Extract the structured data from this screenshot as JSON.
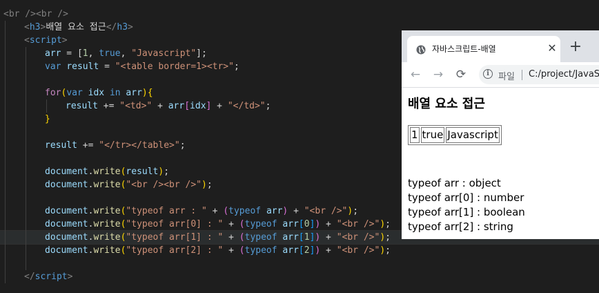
{
  "editor": {
    "lines": [
      {
        "indent": 0,
        "active": false,
        "tokens": [
          {
            "t": "<br /><br />",
            "c": "#808080"
          }
        ]
      },
      {
        "indent": 1,
        "active": false,
        "tokens": [
          {
            "t": "<",
            "c": "#808080"
          },
          {
            "t": "h3",
            "c": "#569cd6"
          },
          {
            "t": ">",
            "c": "#808080"
          },
          {
            "t": "배열 요소 접근",
            "c": "#d4d4d4"
          },
          {
            "t": "</",
            "c": "#808080"
          },
          {
            "t": "h3",
            "c": "#569cd6"
          },
          {
            "t": ">",
            "c": "#808080"
          }
        ]
      },
      {
        "indent": 1,
        "active": false,
        "tokens": [
          {
            "t": "<",
            "c": "#808080"
          },
          {
            "t": "script",
            "c": "#569cd6"
          },
          {
            "t": ">",
            "c": "#808080"
          }
        ]
      },
      {
        "indent": 2,
        "active": false,
        "tokens": [
          {
            "t": "arr",
            "c": "#9cdcfe"
          },
          {
            "t": " = [",
            "c": "#d4d4d4"
          },
          {
            "t": "1",
            "c": "#b5cea8"
          },
          {
            "t": ", ",
            "c": "#d4d4d4"
          },
          {
            "t": "true",
            "c": "#569cd6"
          },
          {
            "t": ", ",
            "c": "#d4d4d4"
          },
          {
            "t": "\"Javascript\"",
            "c": "#ce9178"
          },
          {
            "t": "];",
            "c": "#d4d4d4"
          }
        ]
      },
      {
        "indent": 2,
        "active": false,
        "tokens": [
          {
            "t": "var",
            "c": "#569cd6"
          },
          {
            "t": " ",
            "c": "#d4d4d4"
          },
          {
            "t": "result",
            "c": "#9cdcfe"
          },
          {
            "t": " = ",
            "c": "#d4d4d4"
          },
          {
            "t": "\"<table border=1><tr>\"",
            "c": "#ce9178"
          },
          {
            "t": ";",
            "c": "#d4d4d4"
          }
        ]
      },
      {
        "indent": 0,
        "active": false,
        "tokens": []
      },
      {
        "indent": 2,
        "active": false,
        "tokens": [
          {
            "t": "for",
            "c": "#c586c0"
          },
          {
            "t": "(",
            "c": "#ffd700"
          },
          {
            "t": "var",
            "c": "#569cd6"
          },
          {
            "t": " ",
            "c": "#d4d4d4"
          },
          {
            "t": "idx",
            "c": "#9cdcfe"
          },
          {
            "t": " ",
            "c": "#d4d4d4"
          },
          {
            "t": "in",
            "c": "#569cd6"
          },
          {
            "t": " ",
            "c": "#d4d4d4"
          },
          {
            "t": "arr",
            "c": "#9cdcfe"
          },
          {
            "t": ")",
            "c": "#ffd700"
          },
          {
            "t": "{",
            "c": "#ffd700"
          }
        ]
      },
      {
        "indent": 3,
        "active": false,
        "tokens": [
          {
            "t": "result",
            "c": "#9cdcfe"
          },
          {
            "t": " += ",
            "c": "#d4d4d4"
          },
          {
            "t": "\"<td>\"",
            "c": "#ce9178"
          },
          {
            "t": " + ",
            "c": "#d4d4d4"
          },
          {
            "t": "arr",
            "c": "#9cdcfe"
          },
          {
            "t": "[",
            "c": "#da70d6"
          },
          {
            "t": "idx",
            "c": "#9cdcfe"
          },
          {
            "t": "]",
            "c": "#da70d6"
          },
          {
            "t": " + ",
            "c": "#d4d4d4"
          },
          {
            "t": "\"</td>\"",
            "c": "#ce9178"
          },
          {
            "t": ";",
            "c": "#d4d4d4"
          }
        ]
      },
      {
        "indent": 2,
        "active": false,
        "tokens": [
          {
            "t": "}",
            "c": "#ffd700"
          }
        ]
      },
      {
        "indent": 0,
        "active": false,
        "tokens": []
      },
      {
        "indent": 2,
        "active": false,
        "tokens": [
          {
            "t": "result",
            "c": "#9cdcfe"
          },
          {
            "t": " += ",
            "c": "#d4d4d4"
          },
          {
            "t": "\"</tr></table>\"",
            "c": "#ce9178"
          },
          {
            "t": ";",
            "c": "#d4d4d4"
          }
        ]
      },
      {
        "indent": 0,
        "active": false,
        "tokens": []
      },
      {
        "indent": 2,
        "active": false,
        "tokens": [
          {
            "t": "document",
            "c": "#9cdcfe"
          },
          {
            "t": ".",
            "c": "#d4d4d4"
          },
          {
            "t": "write",
            "c": "#dcdcaa"
          },
          {
            "t": "(",
            "c": "#ffd700"
          },
          {
            "t": "result",
            "c": "#9cdcfe"
          },
          {
            "t": ")",
            "c": "#ffd700"
          },
          {
            "t": ";",
            "c": "#d4d4d4"
          }
        ]
      },
      {
        "indent": 2,
        "active": false,
        "tokens": [
          {
            "t": "document",
            "c": "#9cdcfe"
          },
          {
            "t": ".",
            "c": "#d4d4d4"
          },
          {
            "t": "write",
            "c": "#dcdcaa"
          },
          {
            "t": "(",
            "c": "#ffd700"
          },
          {
            "t": "\"<br /><br />\"",
            "c": "#ce9178"
          },
          {
            "t": ")",
            "c": "#ffd700"
          },
          {
            "t": ";",
            "c": "#d4d4d4"
          }
        ]
      },
      {
        "indent": 0,
        "active": false,
        "tokens": []
      },
      {
        "indent": 2,
        "active": false,
        "tokens": [
          {
            "t": "document",
            "c": "#9cdcfe"
          },
          {
            "t": ".",
            "c": "#d4d4d4"
          },
          {
            "t": "write",
            "c": "#dcdcaa"
          },
          {
            "t": "(",
            "c": "#ffd700"
          },
          {
            "t": "\"typeof arr : \"",
            "c": "#ce9178"
          },
          {
            "t": " + ",
            "c": "#d4d4d4"
          },
          {
            "t": "(",
            "c": "#da70d6"
          },
          {
            "t": "typeof",
            "c": "#569cd6"
          },
          {
            "t": " ",
            "c": "#d4d4d4"
          },
          {
            "t": "arr",
            "c": "#9cdcfe"
          },
          {
            "t": ")",
            "c": "#da70d6"
          },
          {
            "t": " + ",
            "c": "#d4d4d4"
          },
          {
            "t": "\"<br />\"",
            "c": "#ce9178"
          },
          {
            "t": ")",
            "c": "#ffd700"
          },
          {
            "t": ";",
            "c": "#d4d4d4"
          }
        ]
      },
      {
        "indent": 2,
        "active": false,
        "tokens": [
          {
            "t": "document",
            "c": "#9cdcfe"
          },
          {
            "t": ".",
            "c": "#d4d4d4"
          },
          {
            "t": "write",
            "c": "#dcdcaa"
          },
          {
            "t": "(",
            "c": "#ffd700"
          },
          {
            "t": "\"typeof arr[0] : \"",
            "c": "#ce9178"
          },
          {
            "t": " + ",
            "c": "#d4d4d4"
          },
          {
            "t": "(",
            "c": "#da70d6"
          },
          {
            "t": "typeof",
            "c": "#569cd6"
          },
          {
            "t": " ",
            "c": "#d4d4d4"
          },
          {
            "t": "arr",
            "c": "#9cdcfe"
          },
          {
            "t": "[",
            "c": "#179fff"
          },
          {
            "t": "0",
            "c": "#b5cea8"
          },
          {
            "t": "]",
            "c": "#179fff"
          },
          {
            "t": ")",
            "c": "#da70d6"
          },
          {
            "t": " + ",
            "c": "#d4d4d4"
          },
          {
            "t": "\"<br />\"",
            "c": "#ce9178"
          },
          {
            "t": ")",
            "c": "#ffd700"
          },
          {
            "t": ";",
            "c": "#d4d4d4"
          }
        ]
      },
      {
        "indent": 2,
        "active": true,
        "tokens": [
          {
            "t": "document",
            "c": "#9cdcfe"
          },
          {
            "t": ".",
            "c": "#d4d4d4"
          },
          {
            "t": "write",
            "c": "#dcdcaa"
          },
          {
            "t": "(",
            "c": "#ffd700"
          },
          {
            "t": "\"typeof arr[1] : \"",
            "c": "#ce9178"
          },
          {
            "t": " + ",
            "c": "#d4d4d4"
          },
          {
            "t": "(",
            "c": "#da70d6"
          },
          {
            "t": "typeof",
            "c": "#569cd6"
          },
          {
            "t": " ",
            "c": "#d4d4d4"
          },
          {
            "t": "arr",
            "c": "#9cdcfe"
          },
          {
            "t": "[",
            "c": "#179fff"
          },
          {
            "t": "1",
            "c": "#b5cea8"
          },
          {
            "t": "]",
            "c": "#179fff"
          },
          {
            "t": ")",
            "c": "#da70d6"
          },
          {
            "t": " + ",
            "c": "#d4d4d4"
          },
          {
            "t": "\"<br />\"",
            "c": "#ce9178"
          },
          {
            "t": ")",
            "c": "#ffd700"
          },
          {
            "t": ";",
            "c": "#d4d4d4"
          }
        ]
      },
      {
        "indent": 2,
        "active": false,
        "tokens": [
          {
            "t": "document",
            "c": "#9cdcfe"
          },
          {
            "t": ".",
            "c": "#d4d4d4"
          },
          {
            "t": "write",
            "c": "#dcdcaa"
          },
          {
            "t": "(",
            "c": "#ffd700"
          },
          {
            "t": "\"typeof arr[2] : \"",
            "c": "#ce9178"
          },
          {
            "t": " + ",
            "c": "#d4d4d4"
          },
          {
            "t": "(",
            "c": "#da70d6"
          },
          {
            "t": "typeof",
            "c": "#569cd6"
          },
          {
            "t": " ",
            "c": "#d4d4d4"
          },
          {
            "t": "arr",
            "c": "#9cdcfe"
          },
          {
            "t": "[",
            "c": "#179fff"
          },
          {
            "t": "2",
            "c": "#b5cea8"
          },
          {
            "t": "]",
            "c": "#179fff"
          },
          {
            "t": ")",
            "c": "#da70d6"
          },
          {
            "t": " + ",
            "c": "#d4d4d4"
          },
          {
            "t": "\"<br />\"",
            "c": "#ce9178"
          },
          {
            "t": ")",
            "c": "#ffd700"
          },
          {
            "t": ";",
            "c": "#d4d4d4"
          }
        ]
      },
      {
        "indent": 0,
        "active": false,
        "tokens": []
      },
      {
        "indent": 1,
        "active": false,
        "tokens": [
          {
            "t": "</",
            "c": "#808080"
          },
          {
            "t": "script",
            "c": "#569cd6"
          },
          {
            "t": ">",
            "c": "#808080"
          }
        ]
      }
    ]
  },
  "browser": {
    "tab_title": "자바스크립트-배열",
    "close_glyph": "✕",
    "new_tab_glyph": "+",
    "back_glyph": "←",
    "forward_glyph": "→",
    "reload_glyph": "⟳",
    "info_glyph": "i",
    "omnibox_scheme": "파일",
    "omnibox_url": "C:/project/JavaS",
    "page": {
      "heading": "배열 요소 접근",
      "table_cells": [
        "1",
        "true",
        "Javascript"
      ],
      "typeof_lines": [
        "typeof arr : object",
        "typeof arr[0] : number",
        "typeof arr[1] : boolean",
        "typeof arr[2] : string"
      ]
    }
  }
}
